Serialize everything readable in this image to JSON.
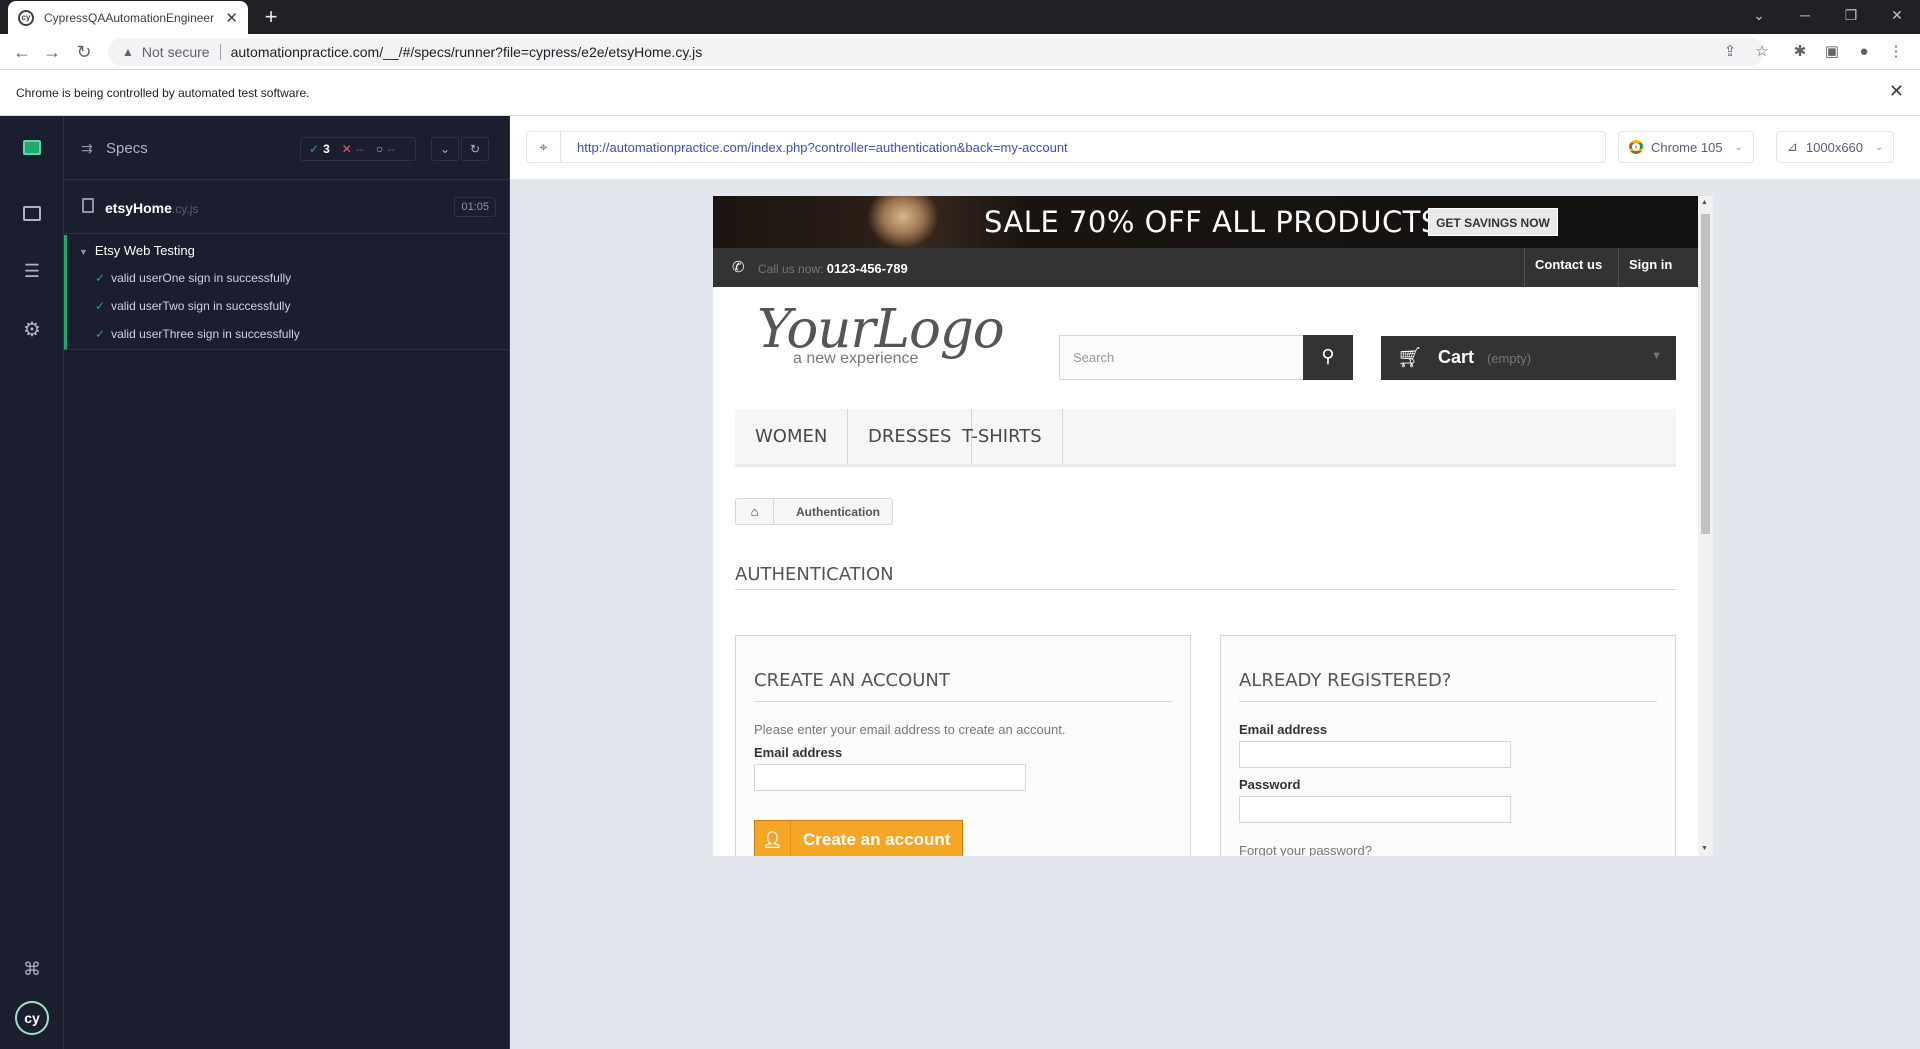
{
  "browser": {
    "tab_title": "CypressQAAutomationEngineer",
    "tab_close": "✕",
    "new_tab": "+",
    "not_secure": "Not secure",
    "url": "automationpractice.com/__/#/specs/runner?file=cypress/e2e/etsyHome.cy.js",
    "infobar_message": "Chrome is being controlled by automated test software.",
    "infobar_close": "✕"
  },
  "cypress": {
    "specs_label": "Specs",
    "stats": {
      "passed": "3",
      "failed": "--",
      "pending": "--"
    },
    "spec_file": {
      "name": "etsyHome",
      "ext": ".cy.js",
      "duration": "01:05"
    },
    "suite": {
      "title": "Etsy Web Testing",
      "tests": [
        {
          "title": "valid userOne sign in successfully",
          "status": "passed"
        },
        {
          "title": "valid userTwo sign in successfully",
          "status": "passed"
        },
        {
          "title": "valid userThree sign in successfully",
          "status": "passed"
        }
      ]
    },
    "aut": {
      "url": "http://automationpractice.com/index.php?controller=authentication&back=my-account",
      "browser": "Chrome 105",
      "viewport": "1000x660"
    },
    "accent_color": "#1fa971"
  },
  "site": {
    "banner": {
      "sale_text": "SALE 70% OFF ALL PRODUCTS",
      "cta": "GET SAVINGS NOW"
    },
    "topbar": {
      "call_label": "Call us now:",
      "phone": "0123-456-789",
      "contact": "Contact us",
      "signin": "Sign in"
    },
    "logo": {
      "main": "YourLogo",
      "tagline": "a new experience"
    },
    "search_placeholder": "Search",
    "cart": {
      "label": "Cart",
      "state": "(empty)"
    },
    "menu": [
      "WOMEN",
      "DRESSES",
      "T-SHIRTS"
    ],
    "breadcrumb": "Authentication",
    "page_heading": "AUTHENTICATION",
    "create_account": {
      "heading": "CREATE AN ACCOUNT",
      "intro": "Please enter your email address to create an account.",
      "email_label": "Email address",
      "button": "Create an account"
    },
    "registered": {
      "heading": "ALREADY REGISTERED?",
      "email_label": "Email address",
      "password_label": "Password",
      "forgot": "Forgot your password?"
    },
    "button_color": "#f6a625"
  }
}
